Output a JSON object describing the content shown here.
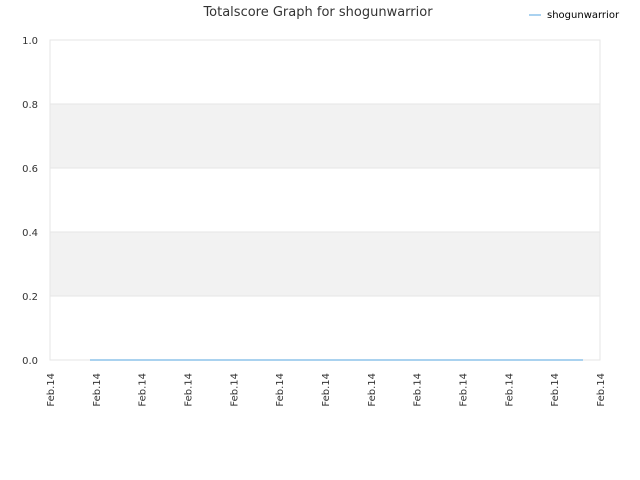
{
  "chart_data": {
    "type": "line",
    "title": "Totalscore Graph for shogunwarrior",
    "xlabel": "",
    "ylabel": "",
    "x_tick_labels": [
      "Feb.14",
      "Feb.14",
      "Feb.14",
      "Feb.14",
      "Feb.14",
      "Feb.14",
      "Feb.14",
      "Feb.14",
      "Feb.14",
      "Feb.14",
      "Feb.14",
      "Feb.14",
      "Feb.14"
    ],
    "y_tick_labels": [
      "0.0",
      "0.2",
      "0.4",
      "0.6",
      "0.8",
      "1.0"
    ],
    "y_ticks": [
      0,
      0.2,
      0.4,
      0.6,
      0.8,
      1.0
    ],
    "ylim": [
      0,
      1.0
    ],
    "grid": "horizontal bands",
    "legend_position": "top-right",
    "series": [
      {
        "name": "shogunwarrior",
        "color": "#8dc3ea",
        "values": [
          0,
          0,
          0,
          0,
          0,
          0,
          0,
          0,
          0,
          0,
          0,
          0
        ]
      }
    ]
  },
  "colors": {
    "band": "#f2f2f2",
    "grid": "#e6e6e6",
    "axis_text": "#333333"
  }
}
